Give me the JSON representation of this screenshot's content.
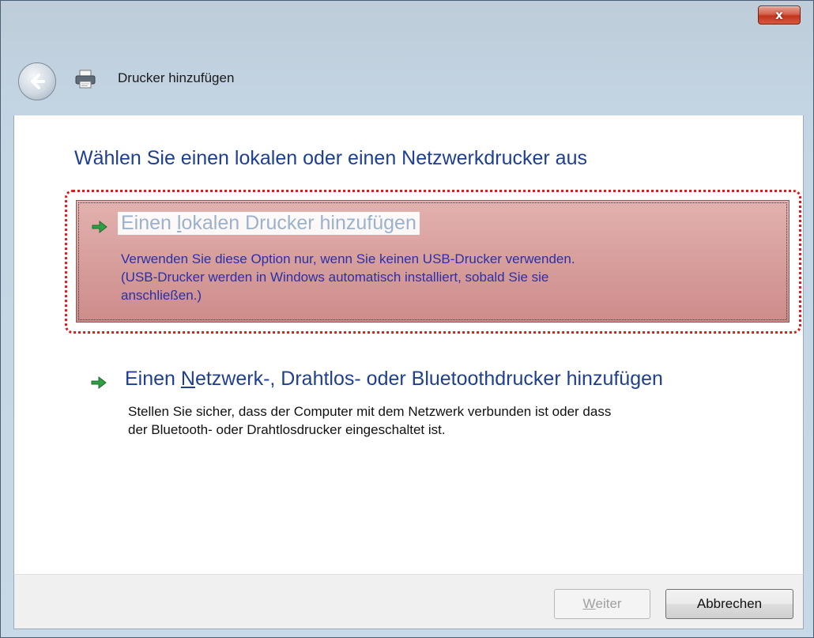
{
  "window": {
    "title": "Drucker hinzufügen",
    "close_label": "x"
  },
  "main": {
    "heading": "Wählen Sie einen lokalen oder einen Netzwerkdrucker aus",
    "options": [
      {
        "title": "Einen lokalen Drucker hinzufügen",
        "access_key": "l",
        "description_lines": [
          "Verwenden Sie diese Option nur, wenn Sie keinen USB-Drucker verwenden.",
          "(USB-Drucker werden in Windows automatisch installiert, sobald Sie sie",
          "anschließen.)"
        ],
        "selected": true
      },
      {
        "title": "Einen Netzwerk-, Drahtlos- oder Bluetoothdrucker hinzufügen",
        "access_key": "N",
        "description_lines": [
          "Stellen Sie sicher, dass der Computer mit dem Netzwerk verbunden ist oder dass",
          "der Bluetooth- oder Drahtlosdrucker eingeschaltet ist."
        ],
        "selected": false
      }
    ]
  },
  "footer": {
    "next_label": "Weiter",
    "next_enabled": false,
    "cancel_label": "Abbrechen"
  },
  "colors": {
    "heading": "#1f3f8f",
    "selected_bg": "#cc8c8a",
    "highlight_ring": "#e01a1a",
    "arrow_green": "#2ea043"
  }
}
